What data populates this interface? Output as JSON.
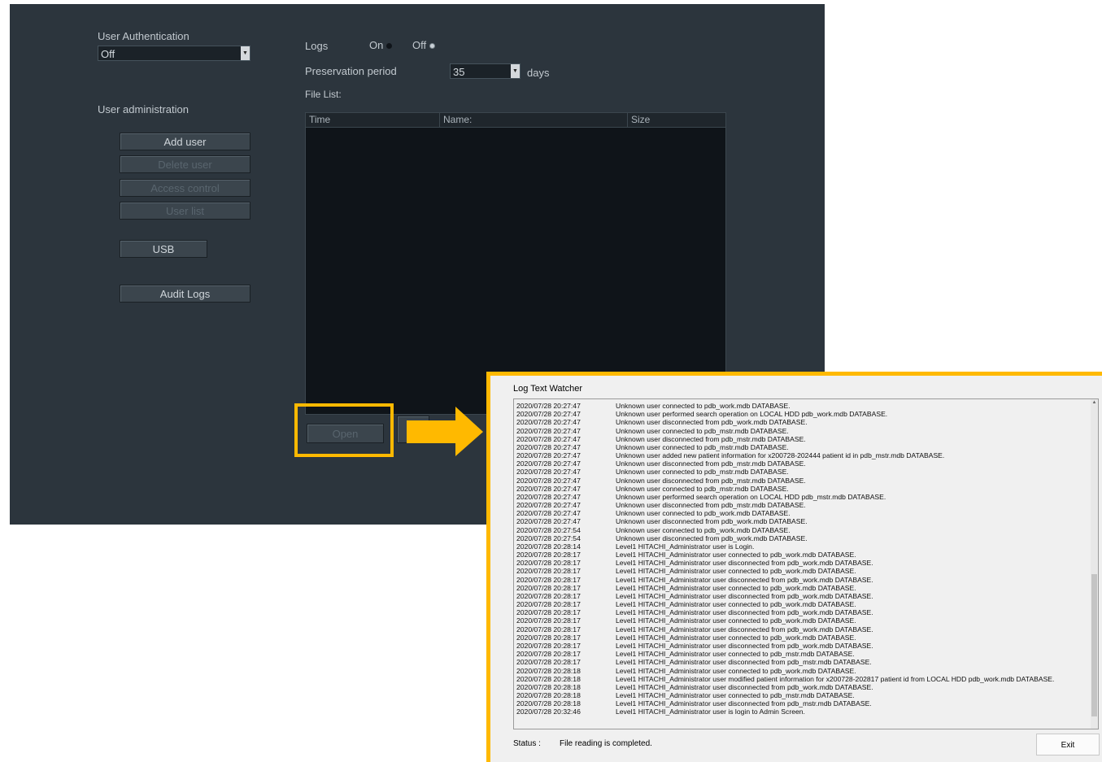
{
  "admin": {
    "user_auth_label": "User Authentication",
    "user_auth_value": "Off",
    "user_admin_label": "User administration",
    "buttons": {
      "add_user": "Add user",
      "delete_user": "Delete user",
      "access_control": "Access control",
      "user_list": "User list",
      "usb": "USB",
      "audit_logs": "Audit Logs",
      "open": "Open"
    },
    "logs_label": "Logs",
    "logs_on": "On",
    "logs_off": "Off",
    "preservation_label": "Preservation period",
    "preservation_value": "35",
    "preservation_unit": "days",
    "file_list_label": "File List:",
    "columns": [
      "Time",
      "Name:",
      "Size"
    ]
  },
  "log_window": {
    "title": "Log Text Watcher",
    "status_label": "Status :",
    "status_text": "File reading is completed.",
    "exit_label": "Exit",
    "lines": [
      [
        "2020/07/28  20:27:47",
        "Unknown user connected to pdb_work.mdb DATABASE."
      ],
      [
        "2020/07/28  20:27:47",
        "Unknown user performed search operation on LOCAL HDD pdb_work.mdb DATABASE."
      ],
      [
        "2020/07/28  20:27:47",
        "Unknown user disconnected from pdb_work.mdb DATABASE."
      ],
      [
        "2020/07/28  20:27:47",
        "Unknown user connected to pdb_mstr.mdb DATABASE."
      ],
      [
        "2020/07/28  20:27:47",
        "Unknown user disconnected from pdb_mstr.mdb DATABASE."
      ],
      [
        "2020/07/28  20:27:47",
        "Unknown user connected to pdb_mstr.mdb DATABASE."
      ],
      [
        "2020/07/28  20:27:47",
        "Unknown user added new patient information for x200728-202444 patient id in pdb_mstr.mdb DATABASE."
      ],
      [
        "2020/07/28  20:27:47",
        "Unknown user disconnected from pdb_mstr.mdb DATABASE."
      ],
      [
        "2020/07/28  20:27:47",
        "Unknown user connected to pdb_mstr.mdb DATABASE."
      ],
      [
        "2020/07/28  20:27:47",
        "Unknown user disconnected from pdb_mstr.mdb DATABASE."
      ],
      [
        "2020/07/28  20:27:47",
        "Unknown user connected to pdb_mstr.mdb DATABASE."
      ],
      [
        "2020/07/28  20:27:47",
        "Unknown user performed search operation on LOCAL HDD pdb_mstr.mdb DATABASE."
      ],
      [
        "2020/07/28  20:27:47",
        "Unknown user disconnected from pdb_mstr.mdb DATABASE."
      ],
      [
        "2020/07/28  20:27:47",
        "Unknown user connected to pdb_work.mdb DATABASE."
      ],
      [
        "2020/07/28  20:27:47",
        "Unknown user disconnected from pdb_work.mdb DATABASE."
      ],
      [
        "2020/07/28  20:27:54",
        "Unknown user connected to pdb_work.mdb DATABASE."
      ],
      [
        "2020/07/28  20:27:54",
        "Unknown user disconnected from pdb_work.mdb DATABASE."
      ],
      [
        "2020/07/28  20:28:14",
        "Level1 HITACHI_Administrator user is Login."
      ],
      [
        "2020/07/28  20:28:17",
        "Level1 HITACHI_Administrator user connected to pdb_work.mdb DATABASE."
      ],
      [
        "2020/07/28  20:28:17",
        "Level1 HITACHI_Administrator user disconnected from pdb_work.mdb DATABASE."
      ],
      [
        "2020/07/28  20:28:17",
        "Level1 HITACHI_Administrator user connected to pdb_work.mdb DATABASE."
      ],
      [
        "2020/07/28  20:28:17",
        "Level1 HITACHI_Administrator user disconnected from pdb_work.mdb DATABASE."
      ],
      [
        "2020/07/28  20:28:17",
        "Level1 HITACHI_Administrator user connected to pdb_work.mdb DATABASE."
      ],
      [
        "2020/07/28  20:28:17",
        "Level1 HITACHI_Administrator user disconnected from pdb_work.mdb DATABASE."
      ],
      [
        "2020/07/28  20:28:17",
        "Level1 HITACHI_Administrator user connected to pdb_work.mdb DATABASE."
      ],
      [
        "2020/07/28  20:28:17",
        "Level1 HITACHI_Administrator user disconnected from pdb_work.mdb DATABASE."
      ],
      [
        "2020/07/28  20:28:17",
        "Level1 HITACHI_Administrator user connected to pdb_work.mdb DATABASE."
      ],
      [
        "2020/07/28  20:28:17",
        "Level1 HITACHI_Administrator user disconnected from pdb_work.mdb DATABASE."
      ],
      [
        "2020/07/28  20:28:17",
        "Level1 HITACHI_Administrator user connected to pdb_work.mdb DATABASE."
      ],
      [
        "2020/07/28  20:28:17",
        "Level1 HITACHI_Administrator user disconnected from pdb_work.mdb DATABASE."
      ],
      [
        "2020/07/28  20:28:17",
        "Level1 HITACHI_Administrator user connected to pdb_mstr.mdb DATABASE."
      ],
      [
        "2020/07/28  20:28:17",
        "Level1 HITACHI_Administrator user disconnected from pdb_mstr.mdb DATABASE."
      ],
      [
        "2020/07/28  20:28:18",
        "Level1 HITACHI_Administrator user connected to pdb_work.mdb DATABASE."
      ],
      [
        "2020/07/28  20:28:18",
        "Level1 HITACHI_Administrator user modified patient information for x200728-202817 patient id from LOCAL HDD pdb_work.mdb DATABASE."
      ],
      [
        "2020/07/28  20:28:18",
        "Level1 HITACHI_Administrator user disconnected from pdb_work.mdb DATABASE."
      ],
      [
        "2020/07/28  20:28:18",
        "Level1 HITACHI_Administrator user connected to pdb_mstr.mdb DATABASE."
      ],
      [
        "2020/07/28  20:28:18",
        "Level1 HITACHI_Administrator user disconnected from pdb_mstr.mdb DATABASE."
      ],
      [
        "2020/07/28  20:32:46",
        "Level1 HITACHI_Administrator user is login to Admin Screen."
      ]
    ]
  },
  "colors": {
    "panel": "#2c353d",
    "highlight": "#ffb900",
    "log_bg": "#f0f0f0"
  }
}
